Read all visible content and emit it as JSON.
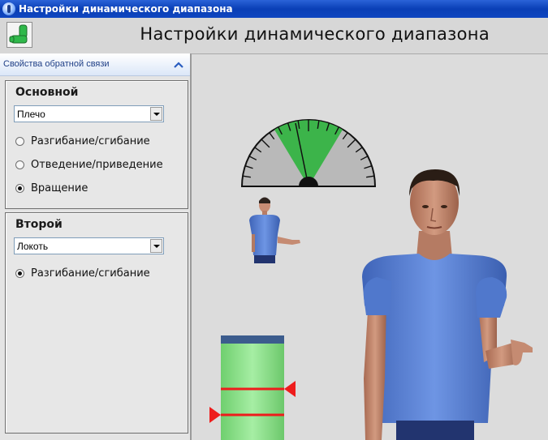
{
  "window": {
    "title": "Настройки динамического диапазона"
  },
  "header": {
    "title": "Настройки динамического диапазона"
  },
  "panel": {
    "label": "Свойства обратной связи",
    "groups": [
      {
        "title": "Основной",
        "select_value": "Плечо",
        "options": [
          {
            "label": "Разгибание/сгибание",
            "checked": false
          },
          {
            "label": "Отведение/приведение",
            "checked": false
          },
          {
            "label": "Вращение",
            "checked": true
          }
        ]
      },
      {
        "title": "Второй",
        "select_value": "Локоть",
        "options": [
          {
            "label": "Разгибание/сгибание",
            "checked": true
          }
        ]
      }
    ]
  },
  "colors": {
    "gauge_active": "#3cb44a",
    "bar_fill": "#8be08a",
    "marker": "#ee1c1c",
    "shirt": "#5d86d8"
  }
}
